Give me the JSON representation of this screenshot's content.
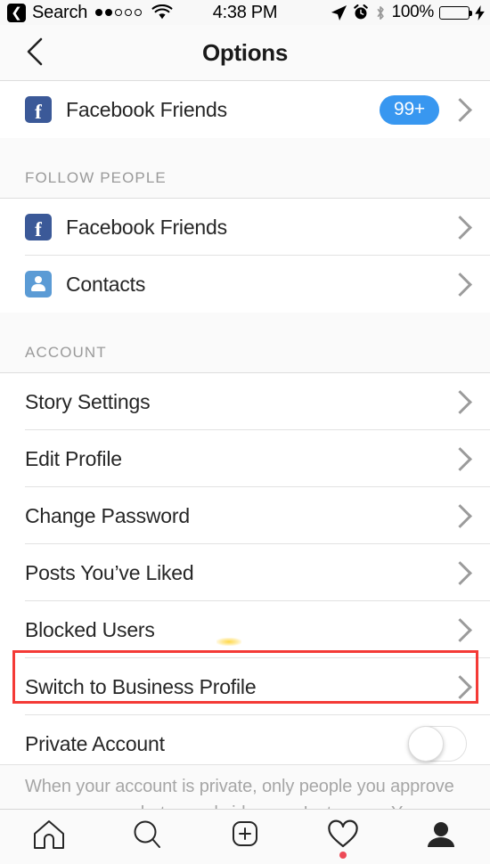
{
  "status_bar": {
    "back_icon": "back-arrow-badge-icon",
    "carrier_label": "Search",
    "signal_dots_filled": 2,
    "signal_dots_total": 5,
    "wifi_icon": "wifi-icon",
    "time": "4:38 PM",
    "location_icon": "location-arrow-icon",
    "alarm_icon": "alarm-clock-icon",
    "bluetooth_icon": "bluetooth-icon",
    "battery_percent": "100%",
    "battery_color": "#4cd964",
    "charging_icon": "lightning-bolt-icon"
  },
  "nav": {
    "back_icon": "chevron-left-icon",
    "title": "Options"
  },
  "top_section": {
    "rows": [
      {
        "label": "Facebook Friends",
        "icon": "facebook-icon",
        "icon_color": "#3b5998",
        "badge": "99+",
        "badge_color": "#3897f0",
        "chevron": "chevron-right-icon"
      }
    ]
  },
  "follow_people_section": {
    "header": "FOLLOW PEOPLE",
    "rows": [
      {
        "label": "Facebook Friends",
        "icon": "facebook-icon",
        "icon_color": "#3b5998",
        "chevron": "chevron-right-icon"
      },
      {
        "label": "Contacts",
        "icon": "contacts-person-icon",
        "icon_color": "#5b9bd5",
        "chevron": "chevron-right-icon"
      }
    ]
  },
  "account_section": {
    "header": "ACCOUNT",
    "rows": [
      {
        "label": "Story Settings",
        "chevron": "chevron-right-icon"
      },
      {
        "label": "Edit Profile",
        "chevron": "chevron-right-icon"
      },
      {
        "label": "Change Password",
        "chevron": "chevron-right-icon"
      },
      {
        "label": "Posts You’ve Liked",
        "chevron": "chevron-right-icon"
      },
      {
        "label": "Blocked Users",
        "chevron": "chevron-right-icon"
      },
      {
        "label": "Switch to Business Profile",
        "chevron": "chevron-right-icon",
        "highlighted": true
      }
    ],
    "private_account": {
      "label": "Private Account",
      "toggle_state": "off"
    },
    "footer_note": "When your account is private, only people you approve can see your photos and videos on Instagram. Your"
  },
  "annotation": {
    "highlight_color": "#f43a36",
    "target_label": "Switch to Business Profile"
  },
  "tab_bar": {
    "tabs": [
      {
        "name": "home",
        "icon": "home-icon",
        "active": false,
        "dot": false
      },
      {
        "name": "search",
        "icon": "search-icon",
        "active": false,
        "dot": false
      },
      {
        "name": "add-post",
        "icon": "plus-square-icon",
        "active": false,
        "dot": false
      },
      {
        "name": "activity",
        "icon": "heart-icon",
        "active": false,
        "dot": true
      },
      {
        "name": "profile",
        "icon": "person-filled-icon",
        "active": true,
        "dot": false
      }
    ],
    "dot_color": "#ed4956"
  }
}
